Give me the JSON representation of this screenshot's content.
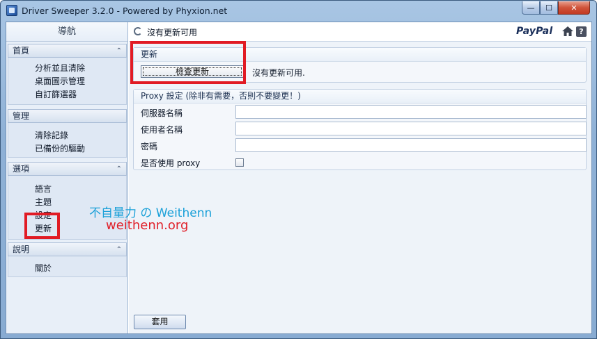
{
  "window": {
    "title": "Driver Sweeper 3.2.0 - Powered by Phyxion.net"
  },
  "sidebar": {
    "title": "導航",
    "groups": [
      {
        "label": "首頁",
        "items": [
          "分析並且清除",
          "桌面圖示管理",
          "自訂篩選器"
        ]
      },
      {
        "label": "管理",
        "items": [
          "清除記錄",
          "已備份的驅動"
        ]
      },
      {
        "label": "選項",
        "items": [
          "語言",
          "主題",
          "設定",
          "更新"
        ]
      },
      {
        "label": "說明",
        "items": [
          "關於"
        ]
      }
    ]
  },
  "header": {
    "status": "沒有更新可用",
    "paypal": "PayPal"
  },
  "update_panel": {
    "title": "更新",
    "check_button": "檢查更新",
    "status": "沒有更新可用."
  },
  "proxy_panel": {
    "title": "Proxy 設定 (除非有需要，否則不要變更！)",
    "fields": [
      {
        "label": "伺服器名稱",
        "value": ""
      },
      {
        "label": "使用者名稱",
        "value": ""
      },
      {
        "label": "密碼",
        "value": ""
      }
    ],
    "use_proxy_label": "是否使用 proxy",
    "use_proxy_checked": false
  },
  "footer": {
    "apply_button": "套用"
  },
  "watermark": {
    "line1": "不自量力 の Weithenn",
    "line2": "weithenn.org"
  },
  "colors": {
    "highlight": "#e11b24",
    "watermark_blue": "#1aa0d8",
    "watermark_red": "#e0202a"
  }
}
